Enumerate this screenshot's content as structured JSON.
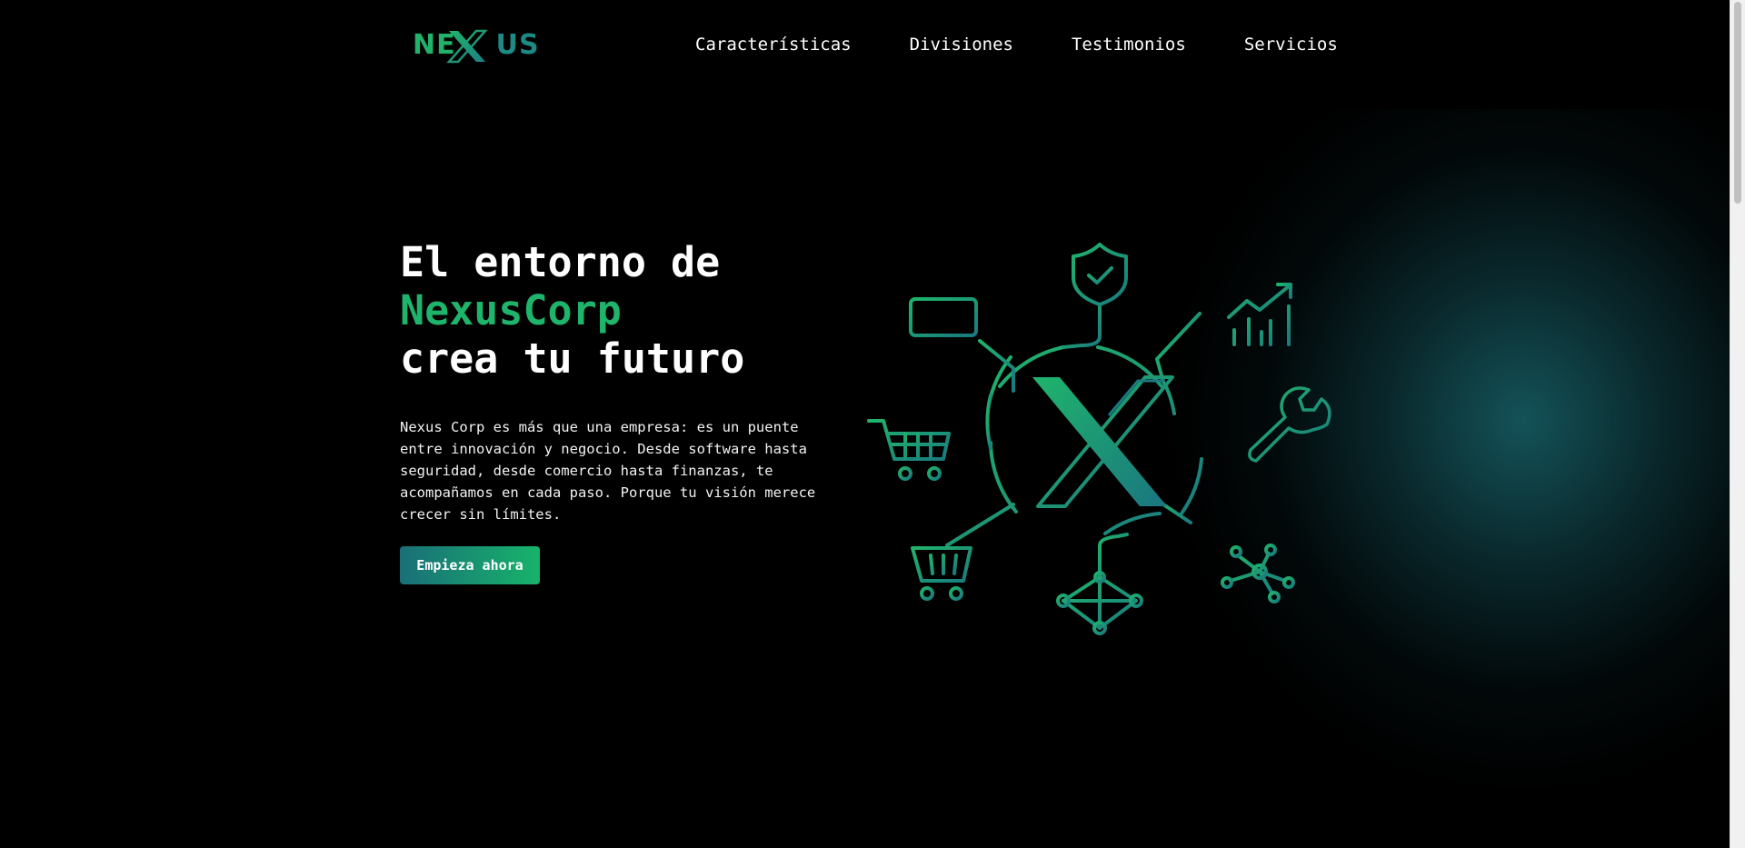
{
  "brand": {
    "logo_text_left": "NE",
    "logo_text_right": "US",
    "logo_icon": "x-mark-icon"
  },
  "nav": {
    "items": [
      {
        "label": "Características"
      },
      {
        "label": "Divisiones"
      },
      {
        "label": "Testimonios"
      },
      {
        "label": "Servicios"
      }
    ]
  },
  "hero": {
    "title_line1": "El entorno de",
    "title_line2": "NexusCorp",
    "title_line3": "crea tu futuro",
    "description": "Nexus Corp es más que una empresa: es un puente entre innovación y negocio. Desde software hasta seguridad, desde comercio hasta finanzas, te acompañamos en cada paso. Porque tu visión merece crecer sin límites.",
    "cta_label": "Empieza ahora"
  },
  "illustration": {
    "icons": [
      "shield-check-icon",
      "laptop-icon",
      "growth-chart-icon",
      "shopping-cart-icon",
      "wrench-icon",
      "basket-icon",
      "network-diamond-icon",
      "network-nodes-icon",
      "x-mark-icon"
    ]
  },
  "colors": {
    "background": "#000000",
    "accent_green": "#1fb46b",
    "accent_teal": "#1a6f78"
  }
}
